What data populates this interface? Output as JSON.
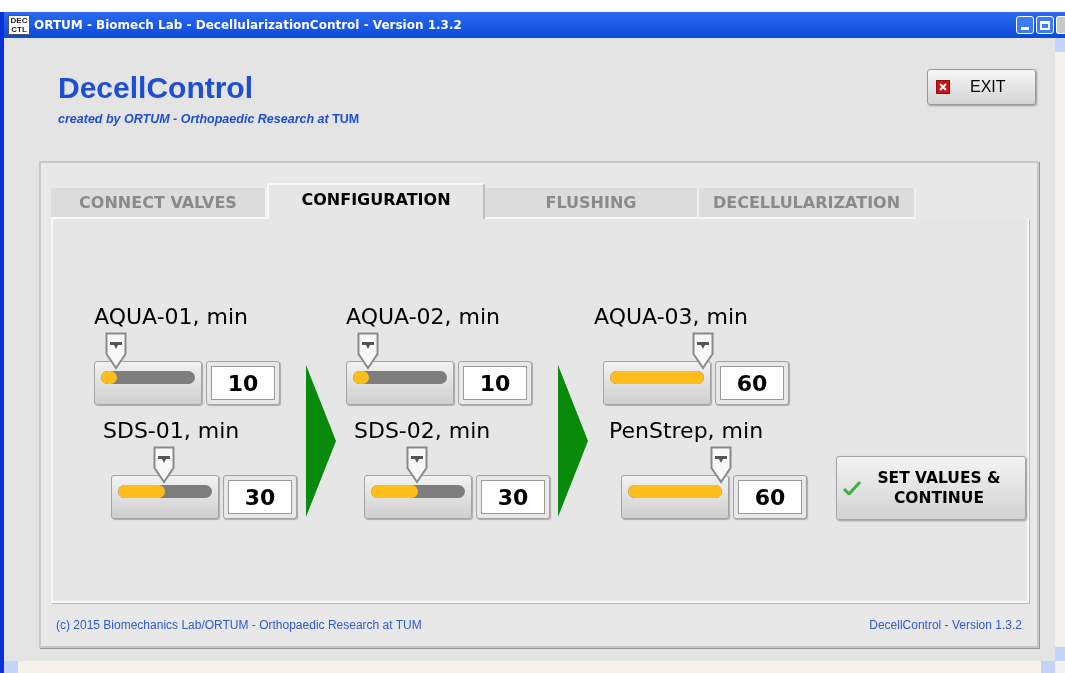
{
  "window": {
    "title": "ORTUM - Biomech Lab - DecellularizationControl - Version 1.3.2",
    "icon_text": [
      "DEC",
      "CTL"
    ]
  },
  "header": {
    "title": "DecellControl",
    "subtitle": "*created by ORTUM - Orthopaedic Research at* TUM"
  },
  "exit_button": {
    "label": "EXIT"
  },
  "tabs": [
    {
      "label": "CONNECT VALVES",
      "selected": false
    },
    {
      "label": "CONFIGURATION",
      "selected": true
    },
    {
      "label": "FLUSHING",
      "selected": false
    },
    {
      "label": "DECELLULARIZATION",
      "selected": false
    }
  ],
  "columns": [
    {
      "sliders": [
        {
          "label": "AQUA-01, min",
          "value": "10",
          "level": 0.17
        },
        {
          "label": "SDS-01, min",
          "value": "30",
          "level": 0.5
        }
      ]
    },
    {
      "sliders": [
        {
          "label": "AQUA-02, min",
          "value": "10",
          "level": 0.17
        },
        {
          "label": "SDS-02, min",
          "value": "30",
          "level": 0.5
        }
      ]
    },
    {
      "sliders": [
        {
          "label": "AQUA-03, min",
          "value": "60",
          "level": 1
        },
        {
          "label": "PenStrep, min",
          "value": "60",
          "level": 1
        }
      ]
    }
  ],
  "action_button": {
    "label": "SET VALUES & CONTINUE"
  },
  "footer": {
    "left": "(c) 2015 Biomechanics Lab/ORTUM - Orthopaedic Research at TUM",
    "right": "DecellControl - Version 1.3.2"
  }
}
